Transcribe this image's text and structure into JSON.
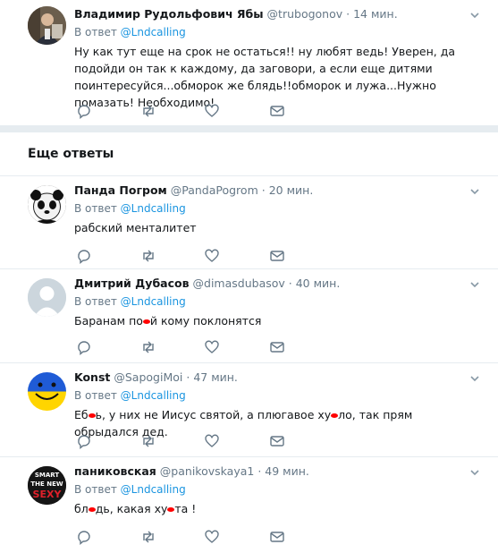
{
  "reply_prefix": "В ответ",
  "section_title": "Еще ответы",
  "tweets": [
    {
      "name": "Владимир Рудольфович Ябы",
      "handle": "@trubogonov",
      "time": "14 мин.",
      "reply_to": "@Lndcalling",
      "text": "Ну как тут еще на срок не остаться!! ну любят ведь! Уверен, да подойди он так к каждому, да заговори, а если еще дитями поинтересуйся...обморок же блядь!!обморок и лужа...Нужно помазать! Необходимо!",
      "avatar": "photo-avatar"
    },
    {
      "name": "Панда Погром",
      "handle": "@PandaPogrom",
      "time": "20 мин.",
      "reply_to": "@Lndcalling",
      "text": "рабский менталитет",
      "avatar": "panda-avatar"
    },
    {
      "name": "Дмитрий Дубасов",
      "handle": "@dimasdubasov",
      "time": "40 мин.",
      "reply_to": "@Lndcalling",
      "text_parts": [
        "Баранам по",
        "й кому поклонятся"
      ],
      "avatar": "default-avatar"
    },
    {
      "name": "Konst",
      "handle": "@SapogiMoi",
      "time": "47 мин.",
      "reply_to": "@Lndcalling",
      "text_parts": [
        "Еб",
        "ь, у них не Иисус святой, а плюгавое ху",
        "ло, так прям обрыдался дед."
      ],
      "avatar": "ukraine-smiley-avatar"
    },
    {
      "name": "паниковская",
      "handle": "@panikovskaya1",
      "time": "49 мин.",
      "reply_to": "@Lndcalling",
      "text_parts": [
        "бл",
        "дь, какая ху",
        "та !"
      ],
      "avatar_text": "SMART THE NEW SEXY",
      "avatar": "smart-sexy-avatar"
    }
  ]
}
